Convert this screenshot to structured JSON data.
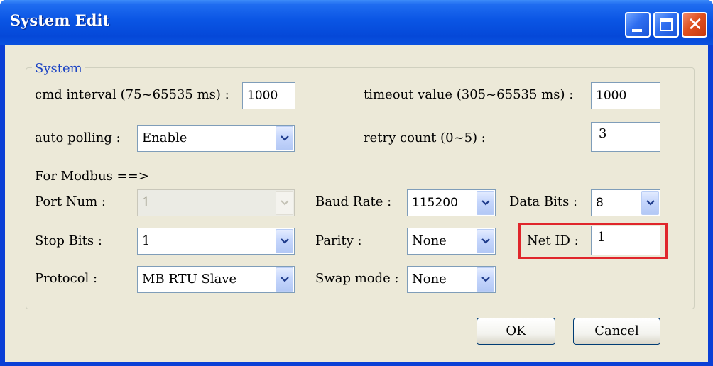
{
  "window": {
    "title": "System Edit",
    "controls": [
      "minimize-icon",
      "maximize-icon",
      "close-icon"
    ]
  },
  "group": {
    "title": "System"
  },
  "cmd_interval": {
    "label": "cmd interval (75~65535 ms) :",
    "value": "1000"
  },
  "timeout_value": {
    "label": "timeout value (305~65535 ms) :",
    "value": "1000"
  },
  "auto_polling": {
    "label": "auto polling :",
    "value": "Enable"
  },
  "retry_count": {
    "label": "retry count (0~5) :",
    "value": "3"
  },
  "modbus_section": {
    "label": "For Modbus ==>"
  },
  "port_num": {
    "label": "Port Num :",
    "value": "1",
    "disabled": true
  },
  "baud_rate": {
    "label": "Baud Rate :",
    "value": "115200"
  },
  "data_bits": {
    "label": "Data Bits :",
    "value": "8"
  },
  "stop_bits": {
    "label": "Stop Bits :",
    "value": "1"
  },
  "parity": {
    "label": "Parity :",
    "value": "None"
  },
  "net_id": {
    "label": "Net ID :",
    "value": "1",
    "highlight_color": "#e0262b"
  },
  "protocol": {
    "label": "Protocol :",
    "value": "MB RTU Slave"
  },
  "swap_mode": {
    "label": "Swap mode :",
    "value": "None"
  },
  "buttons": {
    "ok": "OK",
    "cancel": "Cancel"
  },
  "colors": {
    "titlebar": "#0a55e4",
    "client_bg": "#ece9d8",
    "group_title": "#1c44c4"
  }
}
